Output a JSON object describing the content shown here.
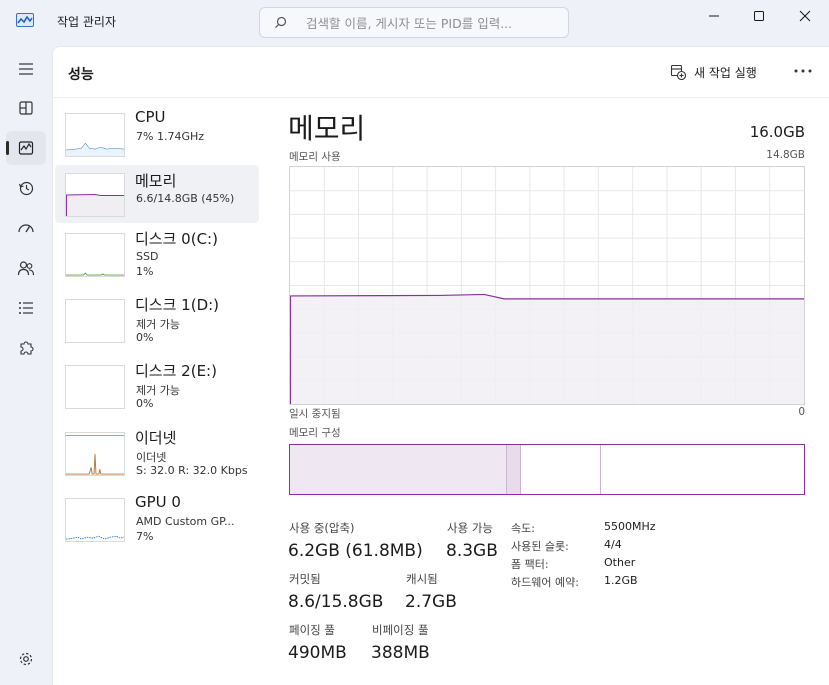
{
  "window": {
    "title": "작업 관리자",
    "search_placeholder": "검색할 이름, 게시자 또는 PID를 입력..."
  },
  "header": {
    "section_title": "성능",
    "new_task_label": "새 작업 실행"
  },
  "devices": [
    {
      "name": "CPU",
      "line1": "7%  1.74GHz",
      "line2": ""
    },
    {
      "name": "메모리",
      "line1": "6.6/14.8GB (45%)",
      "line2": ""
    },
    {
      "name": "디스크 0(C:)",
      "line1": "SSD",
      "line2": "1%"
    },
    {
      "name": "디스크 1(D:)",
      "line1": "제거 가능",
      "line2": "0%"
    },
    {
      "name": "디스크 2(E:)",
      "line1": "제거 가능",
      "line2": "0%"
    },
    {
      "name": "이더넷",
      "line1": "이더넷",
      "line2": "S: 32.0  R: 32.0 Kbps"
    },
    {
      "name": "GPU 0",
      "line1": "AMD Custom GP...",
      "line2": "7%"
    }
  ],
  "detail": {
    "title": "메모리",
    "total": "16.0GB",
    "usage_label": "메모리 사용",
    "usage_max": "14.8GB",
    "axis_left": "일시 중지됨",
    "axis_right": "0",
    "composition_label": "메모리 구성",
    "in_use_fraction": 0.42,
    "modified_fraction": 0.03,
    "standby_fraction": 0.155,
    "colors": {
      "accent": "#8a2f9b",
      "fill": "#f1eef3",
      "grid": "#e6e7ea"
    }
  },
  "stats": {
    "in_use_label": "사용 중(압축)",
    "in_use_value": "6.2GB (61.8MB)",
    "available_label": "사용 가능",
    "available_value": "8.3GB",
    "committed_label": "커밋됨",
    "committed_value": "8.6/15.8GB",
    "cached_label": "캐시됨",
    "cached_value": "2.7GB",
    "paged_label": "페이징 풀",
    "paged_value": "490MB",
    "nonpaged_label": "비페이징 풀",
    "nonpaged_value": "388MB"
  },
  "props": [
    {
      "key": "속도:",
      "value": "5500MHz"
    },
    {
      "key": "사용된 슬롯:",
      "value": "4/4"
    },
    {
      "key": "폼 팩터:",
      "value": "Other"
    },
    {
      "key": "하드웨어 예약:",
      "value": "1.2GB"
    }
  ],
  "icons": {
    "app": "performance-chart-icon",
    "search": "search-icon",
    "minimize": "minimize-icon",
    "maximize": "maximize-icon",
    "close": "close-icon",
    "menu": "hamburger-icon",
    "processes": "processes-icon",
    "performance": "performance-icon",
    "history": "history-icon",
    "startup": "speedometer-icon",
    "users": "users-icon",
    "details": "details-list-icon",
    "services": "puzzle-icon",
    "settings": "gear-icon",
    "new_task": "new-task-icon",
    "more": "more-icon"
  }
}
